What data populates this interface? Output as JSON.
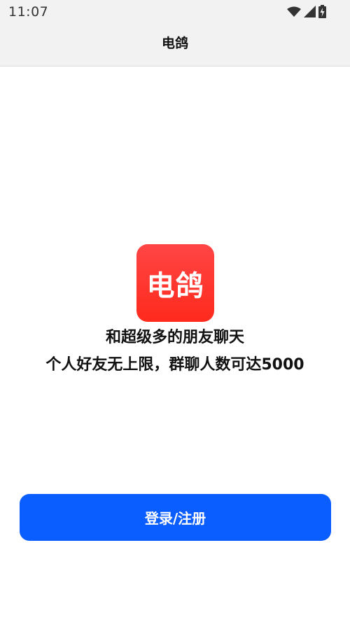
{
  "status_bar": {
    "time": "11:07",
    "icons": [
      "wifi-icon",
      "cellular-signal-icon",
      "battery-charging-icon"
    ]
  },
  "header": {
    "title": "电鸽"
  },
  "main": {
    "logo_text": "电鸽",
    "tagline_line1": "和超级多的朋友聊天",
    "tagline_line2": "个人好友无上限，群聊人数可达5000",
    "login_button_label": "登录/注册"
  },
  "colors": {
    "primary_button": "#0a5dff",
    "logo_background": "#ff3a2f",
    "header_background": "#f2f2f2"
  }
}
